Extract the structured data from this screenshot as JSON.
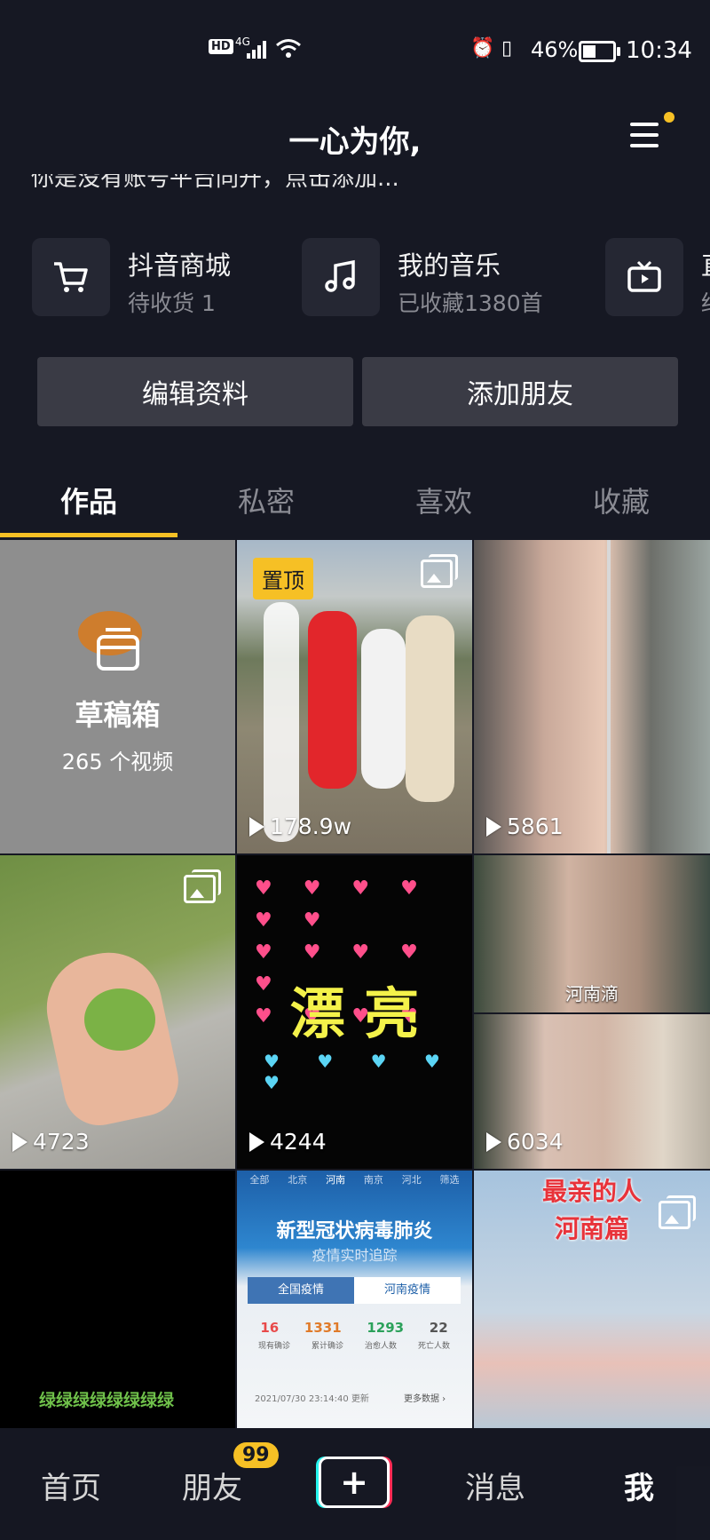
{
  "status_bar": {
    "network": "4G",
    "battery_percent": "46%",
    "time": "10:34",
    "hd_badge": "HD"
  },
  "header": {
    "title": "一心为你,"
  },
  "bio": {
    "text": "你是没有账号平台同开，点击添加..."
  },
  "shortcuts": [
    {
      "label": "抖音商城",
      "sub": "待收货 1",
      "icon": "cart-icon"
    },
    {
      "label": "我的音乐",
      "sub": "已收藏1380首",
      "icon": "music-icon"
    },
    {
      "label": "直",
      "sub": "结",
      "icon": "tv-icon"
    }
  ],
  "actions": {
    "edit_label": "编辑资料",
    "add_friend_label": "添加朋友"
  },
  "tabs": [
    {
      "label": "作品"
    },
    {
      "label": "私密"
    },
    {
      "label": "喜欢"
    },
    {
      "label": "收藏"
    }
  ],
  "grid": {
    "drafts": {
      "title": "草稿箱",
      "count": "265 个视频"
    },
    "pinned_label": "置顶",
    "items": [
      {
        "plays": "178.9w"
      },
      {
        "plays": "5861"
      },
      {
        "plays": "4723"
      },
      {
        "plays": "4244",
        "overlay_text": "漂 亮"
      },
      {
        "plays": "6034",
        "caption": "河南滴"
      },
      {
        "caption": "绿绿绿绿绿绿绿绿"
      },
      {
        "chips": [
          "全部",
          "北京",
          "河南",
          "南京",
          "河北",
          "筛选"
        ],
        "headline": "新型冠状病毒肺炎",
        "subheadline": "疫情实时追踪",
        "tab_a": "全国疫情",
        "tab_b": "河南疫情",
        "stats": [
          "16",
          "1331",
          "1293",
          "22"
        ],
        "stat_labels": [
          "现有确诊",
          "累计确诊",
          "治愈人数",
          "死亡人数"
        ],
        "update": "2021/07/30 23:14:40 更新",
        "more": "更多数据 ›"
      },
      {
        "title_line1": "最亲的人",
        "title_line2": "河南篇"
      }
    ]
  },
  "bottom_nav": {
    "home": "首页",
    "friends": "朋友",
    "friends_badge": "99",
    "plus": "+",
    "messages": "消息",
    "me": "我"
  },
  "colors": {
    "background": "#161823",
    "accent": "#f6c025",
    "pink": "#fe2c55",
    "cyan": "#25f4ee"
  }
}
